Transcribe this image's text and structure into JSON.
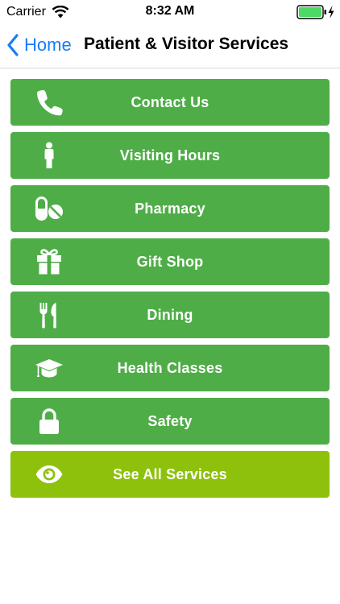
{
  "status_bar": {
    "carrier": "Carrier",
    "time": "8:32 AM",
    "battery_color": "#4cd964"
  },
  "nav": {
    "back_label": "Home",
    "title": "Patient & Visitor Services",
    "back_color": "#1a7cf5"
  },
  "menu": {
    "items": [
      {
        "label": "Contact Us",
        "icon": "phone-icon"
      },
      {
        "label": "Visiting Hours",
        "icon": "person-icon"
      },
      {
        "label": "Pharmacy",
        "icon": "pills-icon"
      },
      {
        "label": "Gift Shop",
        "icon": "gift-icon"
      },
      {
        "label": "Dining",
        "icon": "utensils-icon"
      },
      {
        "label": "Health Classes",
        "icon": "graduation-cap-icon"
      },
      {
        "label": "Safety",
        "icon": "lock-icon"
      },
      {
        "label": "See All Services",
        "icon": "eye-icon"
      }
    ],
    "button_color": "#4fad48",
    "featured_color": "#8dc10b"
  }
}
